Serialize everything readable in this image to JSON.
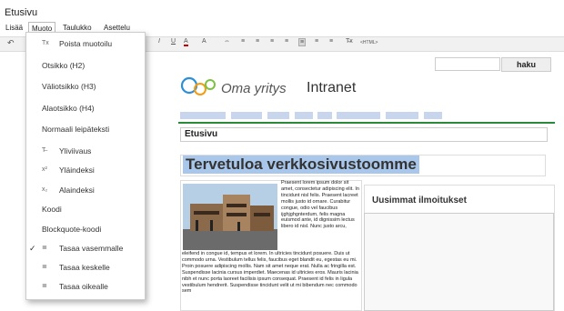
{
  "window": {
    "title": "Etusivu"
  },
  "menubar": {
    "items": [
      "Lisää",
      "Muoto",
      "Taulukko",
      "Asettelu"
    ]
  },
  "toolbar": {
    "left_icon": "↶",
    "buttons": [
      "I",
      "A",
      "A",
      "⇔",
      "≡",
      "≡",
      "≡",
      "≡",
      "≡",
      "≡",
      "≡",
      "≡",
      "T̶x",
      "<HTML>"
    ]
  },
  "dropdown": {
    "items": [
      {
        "icon": "clear-format-icon",
        "glyph": "Tx",
        "label": "Poista muotoilu"
      },
      {
        "icon": "",
        "glyph": "",
        "label": "Otsikko (H2)"
      },
      {
        "icon": "",
        "glyph": "",
        "label": "Väliotsikko (H3)"
      },
      {
        "icon": "",
        "glyph": "",
        "label": "Alaotsikko (H4)"
      },
      {
        "icon": "",
        "glyph": "",
        "label": "Normaali leipäteksti"
      },
      {
        "icon": "strikethrough-icon",
        "glyph": "T̶",
        "label": "Yliviivaus"
      },
      {
        "icon": "superscript-icon",
        "glyph": "x²",
        "label": "Yläindeksi"
      },
      {
        "icon": "subscript-icon",
        "glyph": "x₂",
        "label": "Alaindeksi"
      },
      {
        "icon": "",
        "glyph": "",
        "label": "Koodi"
      },
      {
        "icon": "",
        "glyph": "",
        "label": "Blockquote-koodi"
      },
      {
        "icon": "align-left-icon",
        "glyph": "≣",
        "label": "Tasaa vasemmalle",
        "checked": true
      },
      {
        "icon": "align-center-icon",
        "glyph": "≣",
        "label": "Tasaa keskelle"
      },
      {
        "icon": "align-right-icon",
        "glyph": "≣",
        "label": "Tasaa oikealle"
      }
    ]
  },
  "search": {
    "button": "haku"
  },
  "header": {
    "brand": "Oma yritys",
    "site": "Intranet"
  },
  "breadcrumb": "Etusivu",
  "page": {
    "heading": "Tervetuloa verkkosivustoomme",
    "body_right": "Praesent lorem ipsum dolor sit amet, consectetur adipiscing elit. In tincidunt nisl felis. Praesent lacreet mollis justo id ornare. Curabitur congue, odio vel faucibus ijghjghgnterdum, felis magna euismod ante, id dignissim lectus libero id nisl. Nunc justo arcu,",
    "body_bottom": "eleifend in congue id, tempus et lorem. In ultricies tincidunt posuere. Duis ut commodo urna. Vestibulum tellus felis, faucibus eget blandit eu, egestas eu mi. Proin posuere adipiscing mollis. Nam sit amet neque erat. Nulla ac fringilla est. Suspendisse lacinia cursus imperdiet. Maecenas id ultricies eros. Mauris lacinia nibh et nunc porta laoreet facilisis ipsum consequat. Praesent id felis in ligula vestibulum hendrerit. Suspendisse tincidunt velit ut mi bibendum nec commodo sem"
  },
  "sidebar": {
    "title": "Uusimmat ilmoitukset"
  },
  "colors": {
    "accent": "#a9c7ea",
    "rule": "#2a8a3a"
  }
}
